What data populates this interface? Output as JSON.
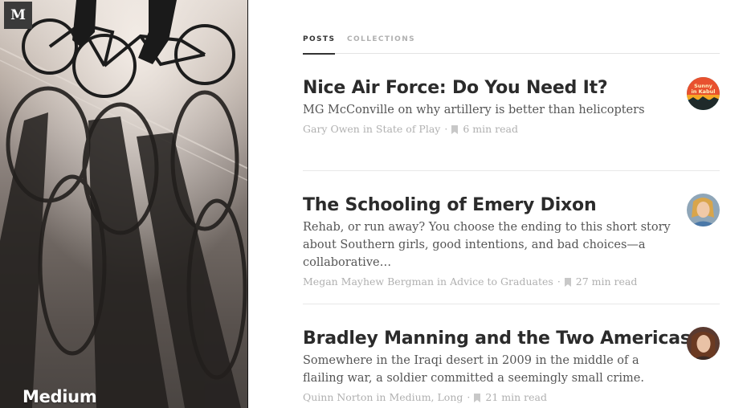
{
  "brand": {
    "logo_letter": "M",
    "name": "Medium"
  },
  "tabs": [
    {
      "label": "POSTS",
      "active": true
    },
    {
      "label": "COLLECTIONS",
      "active": false
    }
  ],
  "posts": [
    {
      "title": "Nice Air Force: Do You Need It?",
      "subtitle": "MG McConville on why artillery is better than helicopters",
      "author": "Gary Owen",
      "in_word": "in",
      "collection": "State of Play",
      "read_time": "6 min read",
      "avatar_text": "Sunny in Kabul"
    },
    {
      "title": "The Schooling of Emery Dixon",
      "subtitle": "Rehab, or run away? You choose the ending to this short story about Southern girls, good intentions, and bad choices—a collaborative…",
      "author": "Megan Mayhew Bergman",
      "in_word": "in",
      "collection": "Advice to Graduates",
      "read_time": "27 min read",
      "avatar_text": ""
    },
    {
      "title": "Bradley Manning and the Two Americas",
      "subtitle": "Somewhere in the Iraqi desert in 2009 in the middle of a flailing war, a soldier committed a seemingly small crime.",
      "author": "Quinn Norton",
      "in_word": "in",
      "collection": "Medium, Long",
      "read_time": "21 min read",
      "avatar_text": ""
    }
  ],
  "icons": {
    "bookmark": "bookmark-icon",
    "logo": "medium-logo-icon"
  },
  "colors": {
    "title": "#2b2b2b",
    "meta": "#b0b0b0",
    "tab_active": "#333333",
    "tab_inactive": "#b0b0b0"
  }
}
